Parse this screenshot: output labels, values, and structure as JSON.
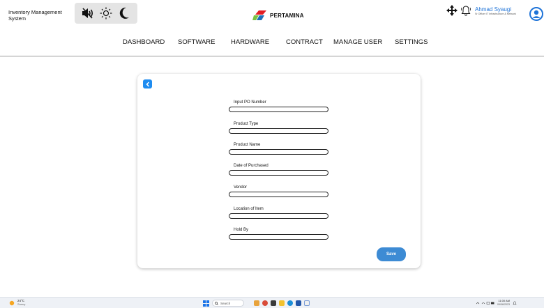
{
  "app": {
    "title": "Inventory Management System",
    "brand": "PERTAMINA"
  },
  "user": {
    "name": "Ahmad Syaugi",
    "role": "Sr Officer IT Infrastructure & Network"
  },
  "nav": [
    {
      "label": "DASHBOARD"
    },
    {
      "label": "SOFTWARE"
    },
    {
      "label": "HARDWARE"
    },
    {
      "label": "CONTRACT"
    },
    {
      "label": "MANAGE USER"
    },
    {
      "label": "SETTINGS"
    }
  ],
  "form": {
    "fields": [
      {
        "label": "Input PO Number",
        "value": ""
      },
      {
        "label": "Product Type",
        "value": ""
      },
      {
        "label": "Product Name",
        "value": ""
      },
      {
        "label": "Date of Purchased",
        "value": ""
      },
      {
        "label": "Vendor",
        "value": ""
      },
      {
        "label": "Location of Item",
        "value": ""
      },
      {
        "label": "Hold By",
        "value": ""
      }
    ],
    "save_label": "Save"
  },
  "taskbar": {
    "weather_temp": "24°C",
    "weather_desc": "Sunny",
    "search_placeholder": "Search",
    "time": "11:00 AM",
    "date": "09/06/2023"
  },
  "icons": {
    "mute": "speaker-muted-icon",
    "light_mode": "sun-icon",
    "dark_mode": "moon-icon",
    "move": "move-arrows-icon",
    "notification": "bell-icon",
    "avatar": "user-avatar-icon",
    "back": "chevron-left-icon"
  },
  "colors": {
    "accent_blue": "#1e8cf0",
    "save_button": "#3d8bd4",
    "brand_red": "#e31e24",
    "brand_green": "#7cc242",
    "brand_blue": "#1f6fb9"
  }
}
